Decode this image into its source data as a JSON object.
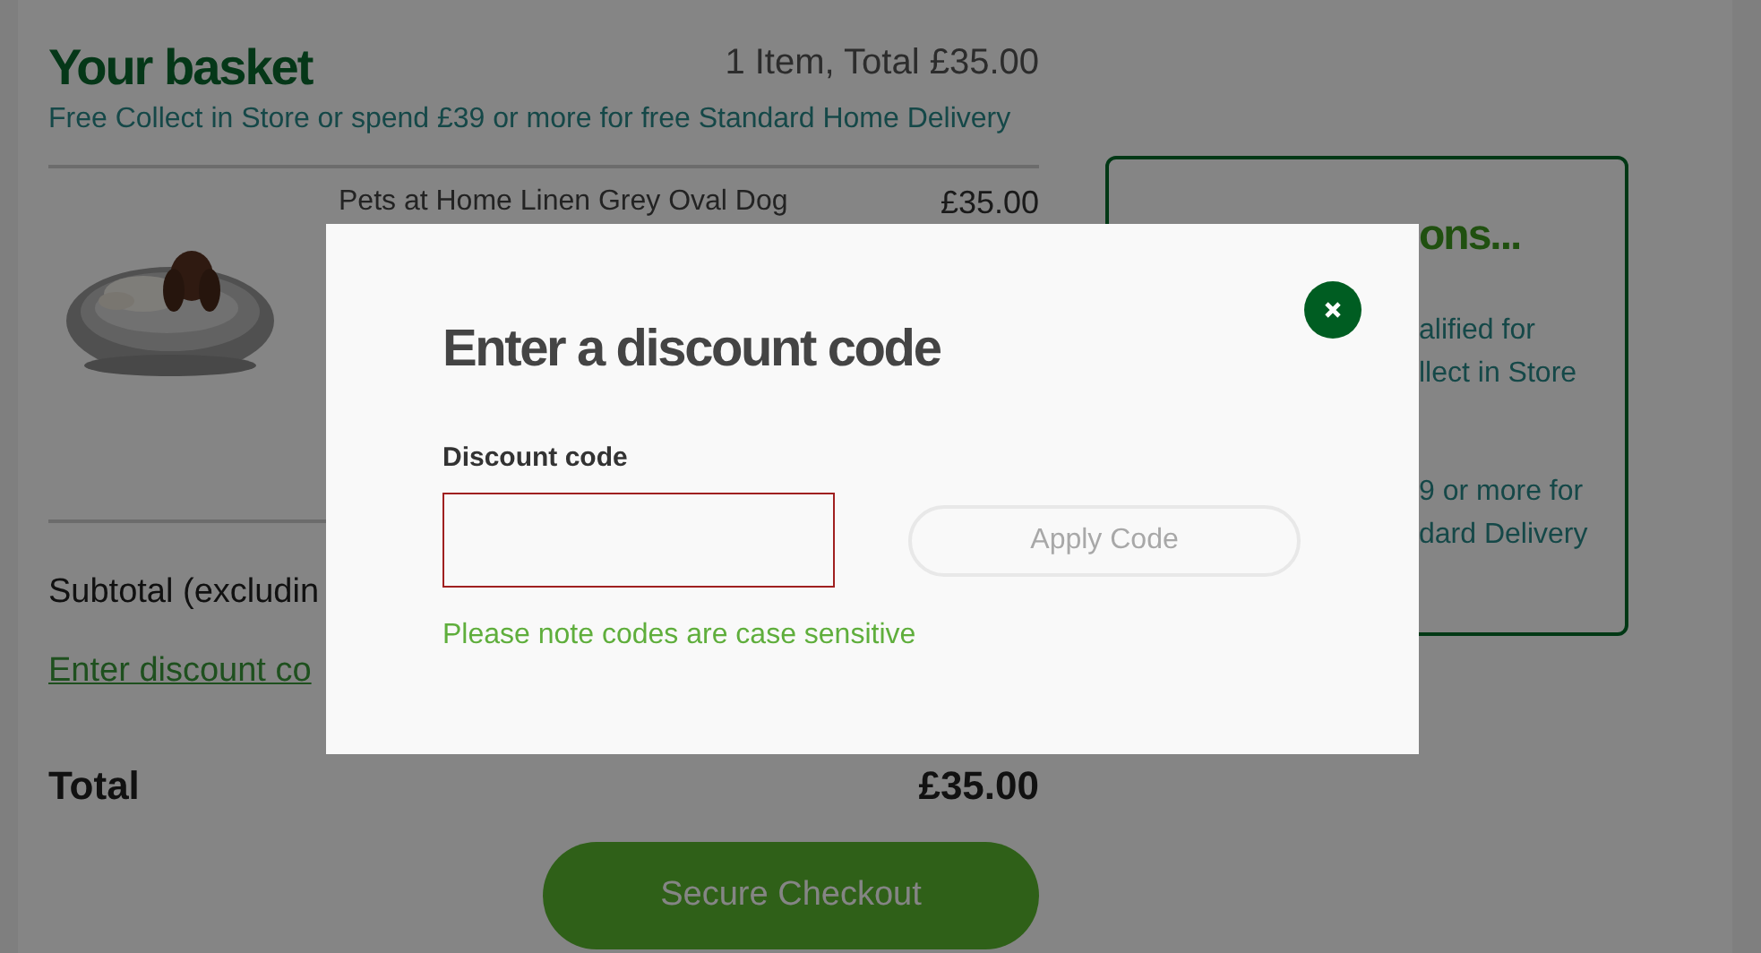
{
  "basket": {
    "title": "Your basket",
    "summary": "1 Item, Total £35.00",
    "delivery_note": "Free Collect in Store or spend £39 or more for free Standard Home Delivery"
  },
  "items": [
    {
      "name": "Pets at Home Linen Grey Oval Dog",
      "price": "£35.00"
    }
  ],
  "subtotal_label": "Subtotal (excludin",
  "discount_link": "Enter discount co",
  "total": {
    "label": "Total",
    "value": "£35.00"
  },
  "checkout_button": "Secure Checkout",
  "delivery_panel": {
    "title": "ons...",
    "lines": [
      "alified for",
      "llect in Store",
      "9 or more for",
      "dard Delivery"
    ]
  },
  "modal": {
    "title": "Enter a discount code",
    "field_label": "Discount code",
    "input": {
      "invalid": true
    },
    "apply_button": {
      "label": "Apply Code",
      "disabled": true
    },
    "note": "Please note codes are case sensitive"
  }
}
